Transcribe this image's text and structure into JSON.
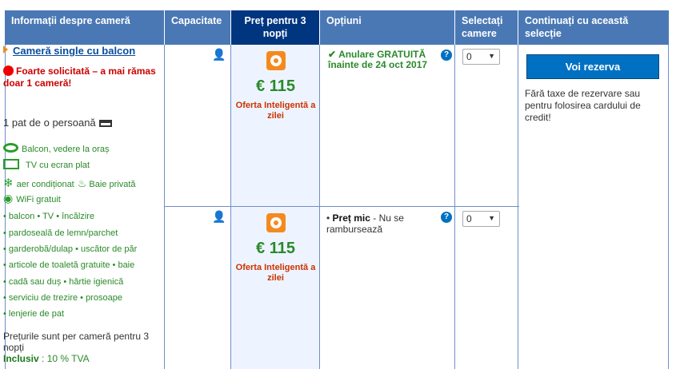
{
  "headers": {
    "room_info": "Informații despre cameră",
    "capacity": "Capacitate",
    "price": "Preț pentru 3 nopți",
    "options": "Opțiuni",
    "select": "Selectați camere",
    "continue": "Continuați cu această selecție"
  },
  "room": {
    "name": "Cameră single cu balcon",
    "alert": "Foarte solicitată – a mai rămas doar 1 cameră!",
    "bed": "1 pat de o persoană",
    "facilities": {
      "balcony": "Balcon, vedere la oraș",
      "tv": "TV cu ecran plat",
      "ac": "aer condiționat",
      "bath": "Baie privată",
      "wifi": "WiFi gratuit"
    },
    "amenity_lines": [
      "• balcon  • TV  • încălzire",
      "• pardoseală de lemn/parchet",
      "• garderobă/dulap  • uscător de păr",
      "• articole de toaletă gratuite  • baie",
      "• cadă sau duș  • hârtie igienică",
      "• serviciu de trezire  • prosoape",
      "• lenjerie de pat"
    ],
    "prices_note": "Prețurile sunt per cameră pentru 3 nopți",
    "included_label": "Inclusiv",
    "included_value": " : 10 % TVA"
  },
  "offers": [
    {
      "price": "€ 115",
      "deal": "Oferta Inteligentă a zilei",
      "option_check": "✔",
      "option_text": "Anulare GRATUITĂ înainte de 24 oct 2017",
      "selected_qty": "0"
    },
    {
      "price": "€ 115",
      "deal": "Oferta Inteligentă a zilei",
      "option_bullet": "•",
      "option_bold": "Preț mic",
      "option_text": " - Nu se rambursează",
      "selected_qty": "0"
    }
  ],
  "booking": {
    "button": "Voi rezerva",
    "note": "Fără taxe de rezervare sau pentru folosirea cardului de credit!"
  },
  "icons": {
    "person": "person-icon",
    "info": "info-icon",
    "dropdown": "▼"
  },
  "colors": {
    "header": "#4a78b5",
    "header_active": "#003580",
    "price_green": "#2a8a2a",
    "alert_red": "#cc0000",
    "accent_orange": "#f48a1f",
    "button_blue": "#0071c2"
  }
}
